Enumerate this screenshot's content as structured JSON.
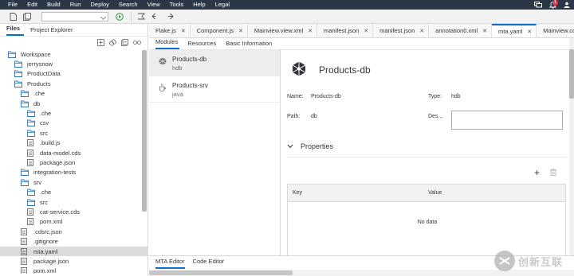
{
  "menubar": {
    "items": [
      "File",
      "Edit",
      "Build",
      "Run",
      "Deploy",
      "Search",
      "View",
      "Tools",
      "Help",
      "Legal"
    ],
    "notification_count": "1"
  },
  "toolbar": {
    "run_config_value": ""
  },
  "left_panel": {
    "tabs": [
      "Files",
      "Project Explorer"
    ],
    "active_tab": "Files",
    "tree": [
      {
        "label": "Workspace",
        "type": "folder",
        "indent": 0
      },
      {
        "label": "jerrysnow",
        "type": "folder",
        "indent": 1
      },
      {
        "label": "ProductData",
        "type": "folder",
        "indent": 1
      },
      {
        "label": "Products",
        "type": "folder",
        "indent": 1
      },
      {
        "label": ".che",
        "type": "folder",
        "indent": 2
      },
      {
        "label": "db",
        "type": "folder",
        "indent": 2
      },
      {
        "label": ".che",
        "type": "folder",
        "indent": 3
      },
      {
        "label": "csv",
        "type": "folder",
        "indent": 3
      },
      {
        "label": "src",
        "type": "folder",
        "indent": 3
      },
      {
        "label": ".build.js",
        "type": "file",
        "indent": 3
      },
      {
        "label": "data-model.cds",
        "type": "file",
        "indent": 3
      },
      {
        "label": "package.json",
        "type": "file",
        "indent": 3
      },
      {
        "label": "integration-tests",
        "type": "folder",
        "indent": 2
      },
      {
        "label": "srv",
        "type": "folder",
        "indent": 2
      },
      {
        "label": ".che",
        "type": "folder",
        "indent": 3
      },
      {
        "label": "src",
        "type": "folder",
        "indent": 3
      },
      {
        "label": "cat-service.cds",
        "type": "file",
        "indent": 3
      },
      {
        "label": "pom.xml",
        "type": "file",
        "indent": 3
      },
      {
        "label": ".cdsrc.json",
        "type": "file",
        "indent": 2
      },
      {
        "label": ".gitignore",
        "type": "file",
        "indent": 2
      },
      {
        "label": "mta.yaml",
        "type": "file",
        "indent": 2,
        "selected": true
      },
      {
        "label": "package.json",
        "type": "file",
        "indent": 2
      },
      {
        "label": "pom.xml",
        "type": "file",
        "indent": 2
      }
    ]
  },
  "editor_tabs": [
    {
      "label": "Flake.js",
      "active": false
    },
    {
      "label": "Component.js",
      "active": false
    },
    {
      "label": "Mainview.view.xml",
      "active": false
    },
    {
      "label": "manifest.json",
      "active": false
    },
    {
      "label": "manifest.json",
      "active": false
    },
    {
      "label": "annotation0.xml",
      "active": false
    },
    {
      "label": "mta.yaml",
      "active": true
    },
    {
      "label": "Mainview.co",
      "active": false
    }
  ],
  "mta_tabs": [
    "Modules",
    "Resources",
    "Basic Information"
  ],
  "modules": [
    {
      "name": "Products-db",
      "type": "hdb",
      "selected": true
    },
    {
      "name": "Products-srv",
      "type": "java",
      "selected": false
    }
  ],
  "detail": {
    "title": "Products-db",
    "name_label": "Name:",
    "name_value": "Products-db",
    "type_label": "Type:",
    "type_value": "hdb",
    "path_label": "Path:",
    "path_value": "db",
    "desc_label": "Des...",
    "properties_title": "Properties",
    "add_label": "+",
    "table_key_header": "Key",
    "table_value_header": "Value",
    "no_data": "No data"
  },
  "bottom_tabs": [
    "MTA Editor",
    "Code Editor"
  ],
  "watermark": {
    "text": "创新互联"
  },
  "colors": {
    "menubar_bg": "#2b3646",
    "accent": "#0a6ed1",
    "folder_icon": "#2f76b5",
    "selected_row": "#dcdcdc",
    "notification": "#d9364c"
  }
}
